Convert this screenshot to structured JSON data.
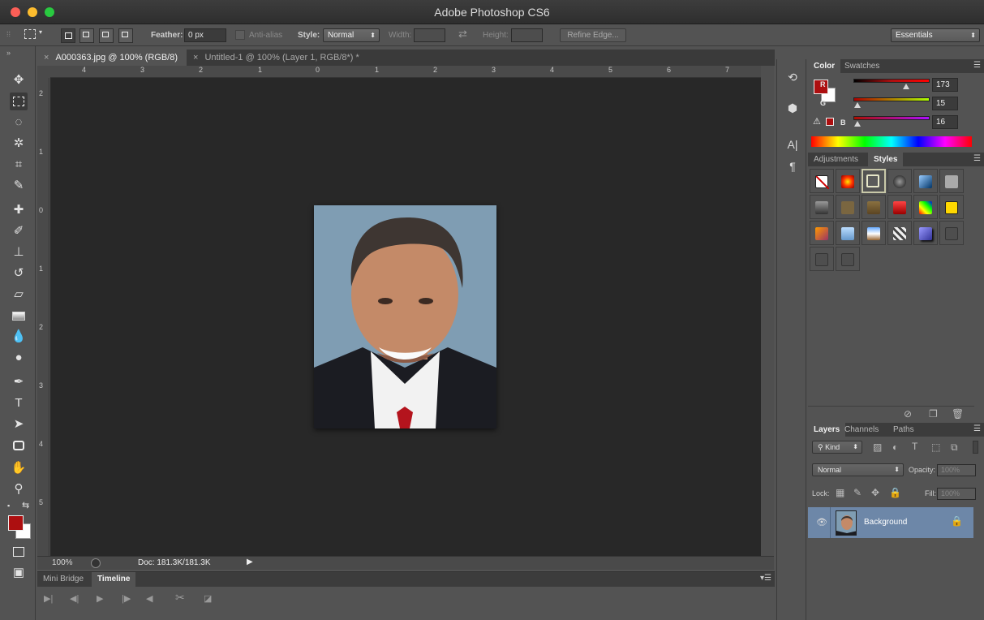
{
  "app": {
    "title": "Adobe Photoshop CS6"
  },
  "options_bar": {
    "feather_label": "Feather:",
    "feather_value": "0 px",
    "antialias_label": "Anti-alias",
    "style_label": "Style:",
    "style_value": "Normal",
    "width_label": "Width:",
    "height_label": "Height:",
    "refine_edge_label": "Refine Edge...",
    "workspace_value": "Essentials"
  },
  "document_tabs": [
    {
      "label": "A000363.jpg @ 100% (RGB/8)",
      "active": true
    },
    {
      "label": "Untitled-1 @ 100% (Layer 1, RGB/8*) *",
      "active": false
    }
  ],
  "rulers": {
    "horizontal": [
      "4",
      "3",
      "2",
      "1",
      "0",
      "1",
      "2",
      "3",
      "4",
      "5",
      "6",
      "7"
    ],
    "vertical": [
      "2",
      "1",
      "0",
      "1",
      "2",
      "3",
      "4",
      "5"
    ]
  },
  "status_bar": {
    "zoom": "100%",
    "doc_info": "Doc: 181.3K/181.3K"
  },
  "timeline_panel": {
    "tabs": [
      "Mini Bridge",
      "Timeline"
    ],
    "active_tab": "Timeline"
  },
  "color_panel": {
    "tabs": [
      "Color",
      "Swatches"
    ],
    "active_tab": "Color",
    "channels": [
      {
        "label": "R",
        "value": "173"
      },
      {
        "label": "G",
        "value": "15"
      },
      {
        "label": "B",
        "value": "16"
      }
    ],
    "foreground_color": "#ad0f10",
    "background_color": "#ffffff"
  },
  "styles_panel": {
    "tabs": [
      "Adjustments",
      "Styles"
    ],
    "active_tab": "Styles"
  },
  "layers_panel": {
    "tabs": [
      "Layers",
      "Channels",
      "Paths"
    ],
    "active_tab": "Layers",
    "kind_filter": "Kind",
    "blend_mode": "Normal",
    "opacity_label": "Opacity:",
    "opacity_value": "100%",
    "lock_label": "Lock:",
    "fill_label": "Fill:",
    "fill_value": "100%",
    "layers": [
      {
        "name": "Background",
        "locked": true,
        "visible": true
      }
    ]
  },
  "colors": {
    "foreground": "#ad0f10",
    "selected_layer": "#6d87a8",
    "canvas_bg": "#282828",
    "panel_bg": "#535353"
  }
}
